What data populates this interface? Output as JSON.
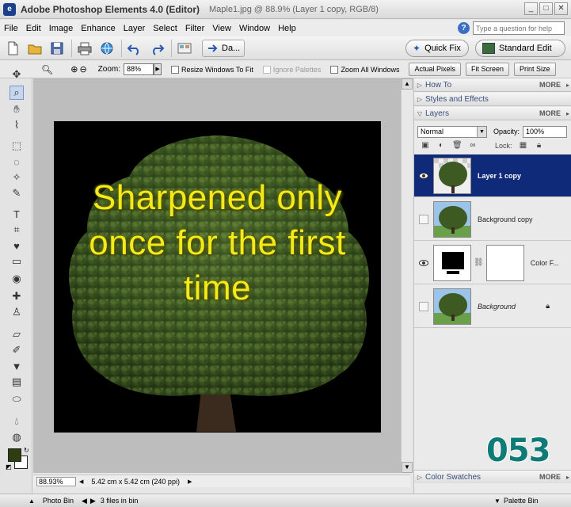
{
  "window": {
    "app_title": "Adobe Photoshop Elements 4.0 (Editor)",
    "doc_title": "Maple1.jpg @ 88.9% (Layer 1 copy, RGB/8)"
  },
  "menu": [
    "File",
    "Edit",
    "Image",
    "Enhance",
    "Layer",
    "Select",
    "Filter",
    "View",
    "Window",
    "Help"
  ],
  "help": {
    "placeholder": "Type a question for help"
  },
  "shortcuts": {
    "create_label": "Da...",
    "quick_fix": "Quick Fix",
    "standard_edit": "Standard Edit"
  },
  "options": {
    "zoom_label": "Zoom:",
    "zoom_value": "88%",
    "resize_windows": "Resize Windows To Fit",
    "ignore_palettes": "Ignore Palettes",
    "zoom_all": "Zoom All Windows",
    "actual_pixels": "Actual Pixels",
    "fit_screen": "Fit Screen",
    "print_size": "Print Size"
  },
  "canvas": {
    "overlay_text": "Sharpened only\nonce for the first\ntime"
  },
  "status": {
    "zoom": "88.93%",
    "size": "5.42 cm x 5.42 cm (240 ppi)"
  },
  "palette": {
    "how_to": "How To",
    "styles": "Styles and Effects",
    "layers": "Layers",
    "more": "MORE",
    "blend_mode": "Normal",
    "opacity_label": "Opacity:",
    "opacity_value": "100%",
    "lock_label": "Lock:",
    "color_swatches": "Color Swatches"
  },
  "layers": [
    {
      "name": "Layer 1 copy",
      "visible": true,
      "selected": true
    },
    {
      "name": "Background copy",
      "visible": false,
      "selected": false
    },
    {
      "name": "Color F...",
      "visible": true,
      "selected": false
    },
    {
      "name": "Background",
      "visible": false,
      "selected": false
    }
  ],
  "counter": "053",
  "photobin": {
    "label": "Photo Bin",
    "files": "3 files in bin",
    "palette_bin": "Palette Bin"
  },
  "colors": {
    "foreground": "#2e3e10",
    "background": "#ffffff",
    "overlay_text": "#f2ea1a",
    "selected_layer": "#0f2a78",
    "counter": "#0e7b76"
  }
}
